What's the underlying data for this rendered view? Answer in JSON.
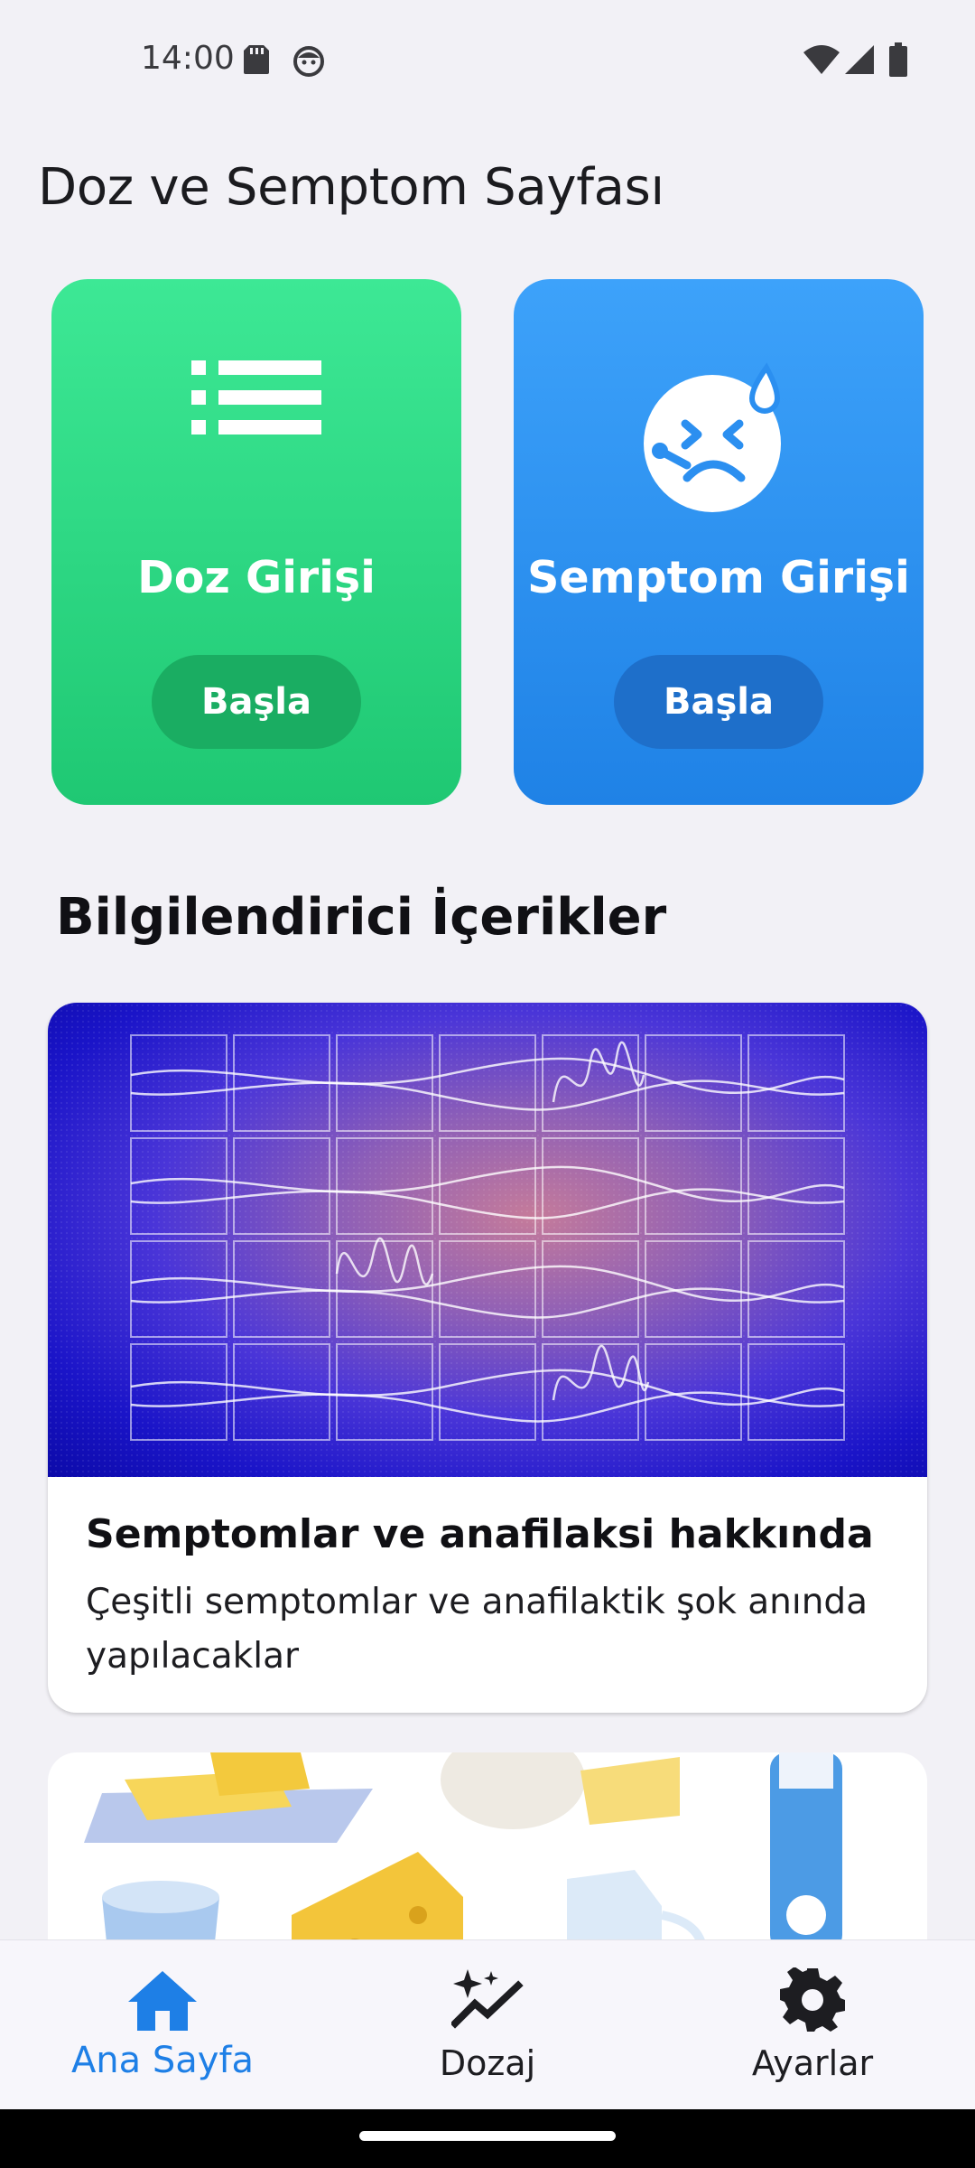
{
  "status_bar": {
    "time": "14:00",
    "icons_left": [
      "sd-card-icon",
      "face-icon"
    ],
    "icons_right": [
      "wifi-icon",
      "signal-icon",
      "battery-icon"
    ]
  },
  "page_title": "Doz ve Semptom Sayfası",
  "action_cards": [
    {
      "title": "Doz Girişi",
      "button": "Başla",
      "icon": "list-icon",
      "color": "#2fd680"
    },
    {
      "title": "Semptom Girişi",
      "button": "Başla",
      "icon": "sick-face-icon",
      "color": "#2b8ff0"
    }
  ],
  "section_title": "Bilgilendirici İçerikler",
  "info_cards": [
    {
      "title": "Semptomlar ve anafilaksi hakkında",
      "description": "Çeşitli semptomlar ve anafilaktik şok anında yapılacaklar",
      "image": "nerve-signals-grid-illustration"
    },
    {
      "image": "dairy-products-illustration"
    }
  ],
  "bottom_nav": [
    {
      "label": "Ana Sayfa",
      "icon": "home-icon",
      "active": true
    },
    {
      "label": "Dozaj",
      "icon": "sparkle-chart-icon",
      "active": false
    },
    {
      "label": "Ayarlar",
      "icon": "settings-gear-icon",
      "active": false
    }
  ],
  "colors": {
    "accent": "#1e7fe6",
    "background": "#f2f1f6"
  }
}
